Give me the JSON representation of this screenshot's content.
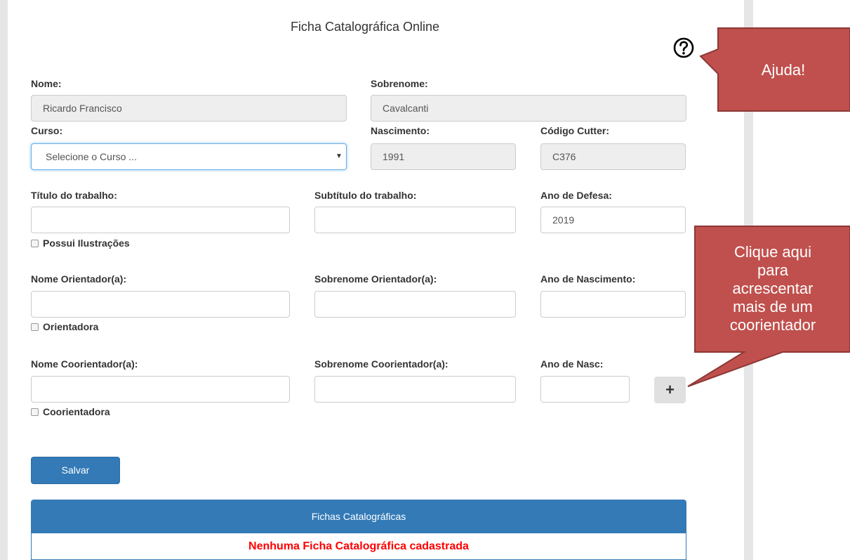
{
  "page_title": "Ficha Catalográfica Online",
  "form": {
    "nome": {
      "label": "Nome:",
      "value": "Ricardo Francisco"
    },
    "sobrenome": {
      "label": "Sobrenome:",
      "value": "Cavalcanti"
    },
    "curso": {
      "label": "Curso:",
      "selected": "Selecione o Curso ..."
    },
    "nascimento": {
      "label": "Nascimento:",
      "value": "1991"
    },
    "cutter": {
      "label": "Código Cutter:",
      "value": "C376"
    },
    "titulo": {
      "label": "Título do trabalho:",
      "value": ""
    },
    "subtitulo": {
      "label": "Subtítulo do trabalho:",
      "value": ""
    },
    "ano_defesa": {
      "label": "Ano de Defesa:",
      "value": "2019"
    },
    "ilustracoes": {
      "label": "Possui Ilustrações",
      "checked": false
    },
    "orientador_nome": {
      "label": "Nome Orientador(a):",
      "value": ""
    },
    "orientador_sobrenome": {
      "label": "Sobrenome Orientador(a):",
      "value": ""
    },
    "orientador_ano": {
      "label": "Ano de Nascimento:",
      "value": ""
    },
    "orientadora": {
      "label": "Orientadora",
      "checked": false
    },
    "coorientador_nome": {
      "label": "Nome Coorientador(a):",
      "value": ""
    },
    "coorientador_sobrenome": {
      "label": "Sobrenome Coorientador(a):",
      "value": ""
    },
    "coorientador_ano": {
      "label": "Ano de Nasc:",
      "value": ""
    },
    "coorientadora": {
      "label": "Coorientadora",
      "checked": false
    },
    "add_button": "+",
    "save_button": "Salvar"
  },
  "panel": {
    "title": "Fichas Catalográficas",
    "empty_message": "Nenhuma Ficha Catalográfica cadastrada"
  },
  "callouts": {
    "help": "Ajuda!",
    "add_coorientador": [
      "Clique aqui",
      "para",
      "acrescentar",
      "mais de um",
      "coorientador"
    ]
  },
  "icons": {
    "help": "question-circle-icon",
    "dropdown": "caret-down-icon"
  },
  "colors": {
    "primary": "#337ab7",
    "callout": "#c0504d",
    "error": "#ff0000",
    "readonly": "#eeeeee"
  }
}
